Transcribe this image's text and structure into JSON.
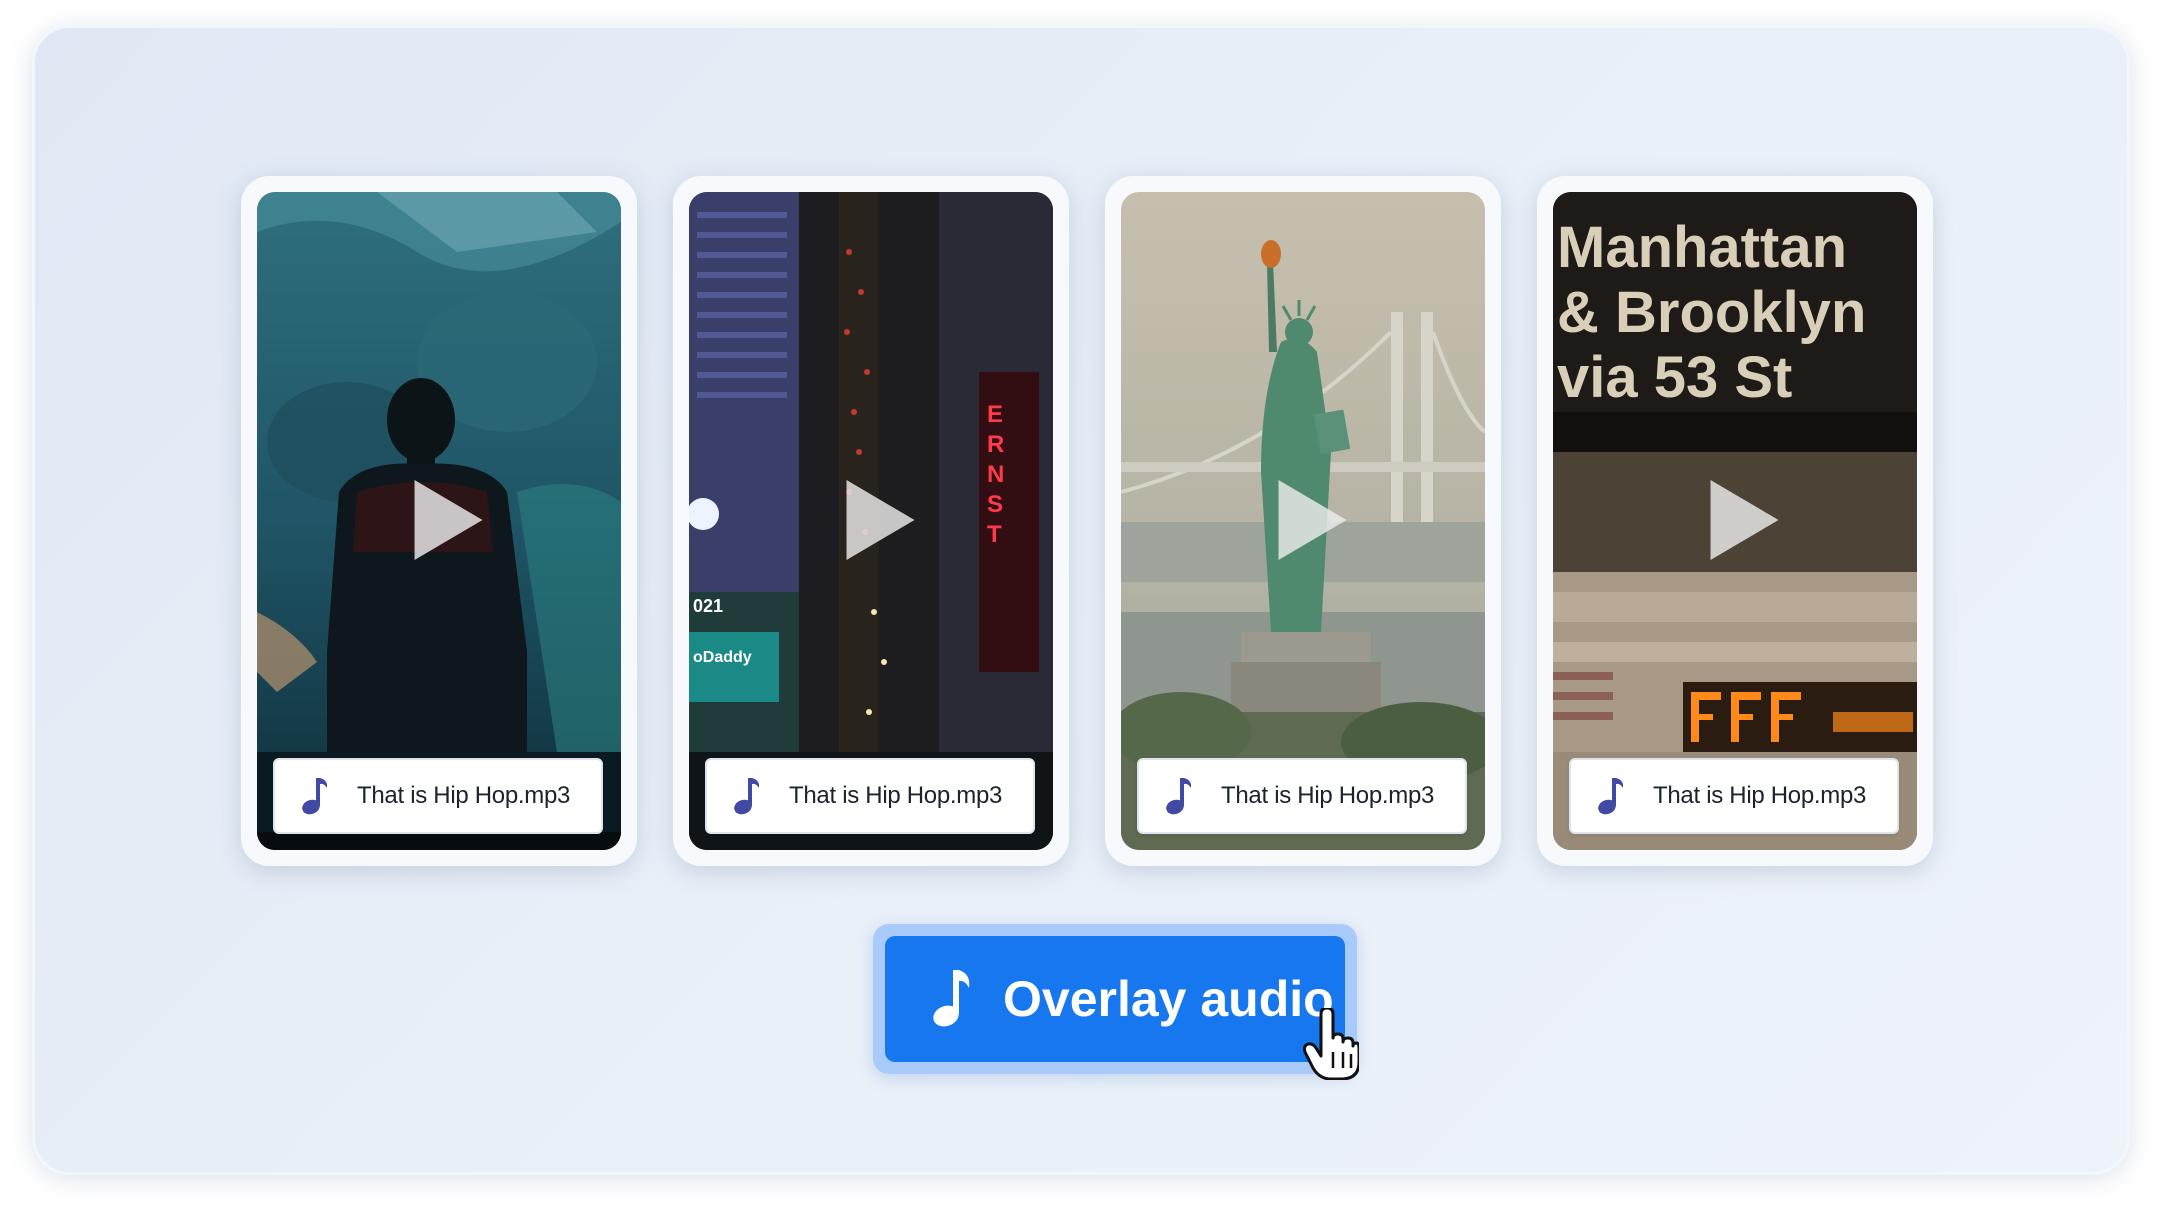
{
  "cards": [
    {
      "audio_label": "That is Hip Hop.mp3",
      "icon": "music-note-icon",
      "play_icon": "play-icon"
    },
    {
      "audio_label": "That is Hip Hop.mp3",
      "icon": "music-note-icon",
      "play_icon": "play-icon"
    },
    {
      "audio_label": "That is Hip Hop.mp3",
      "icon": "music-note-icon",
      "play_icon": "play-icon"
    },
    {
      "audio_label": "That is Hip Hop.mp3",
      "icon": "music-note-icon",
      "play_icon": "play-icon"
    }
  ],
  "card4_sign": {
    "line1": "Manhattan",
    "line2": "& Brooklyn",
    "line3": "via 53 St"
  },
  "card2_sign": {
    "word1": "ERNST",
    "brand": "oDaddy",
    "year": "021"
  },
  "primary_action": {
    "label": "Overlay audio",
    "icon": "music-note-icon"
  },
  "colors": {
    "accent": "#1677ee",
    "accent_outline": "#a8cbfb",
    "note_icon": "#3f4aa0"
  }
}
